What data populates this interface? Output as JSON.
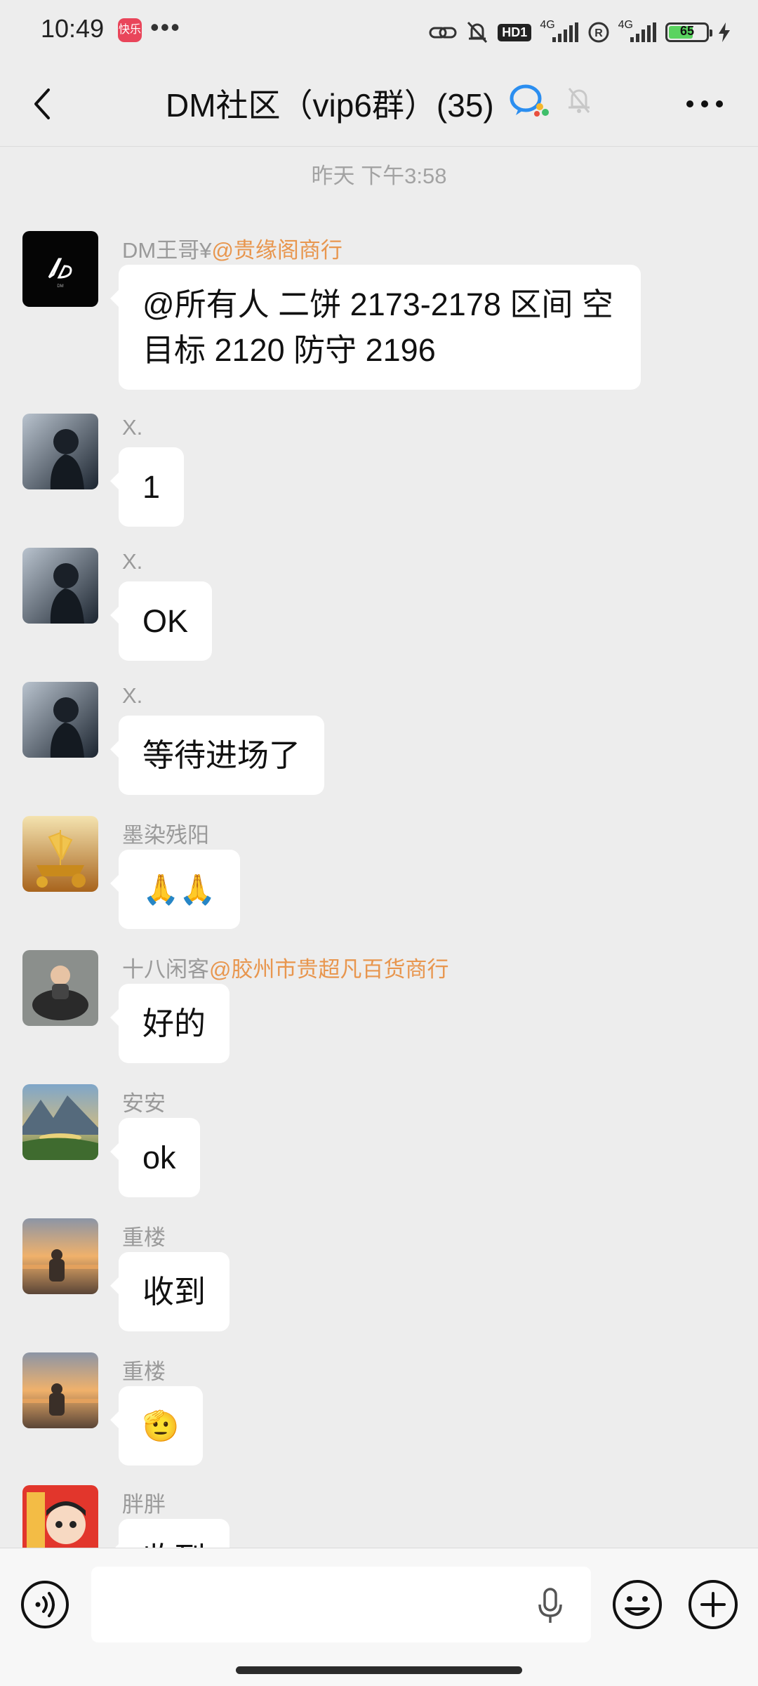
{
  "status_bar": {
    "time": "10:49",
    "app_icon_text": "快乐",
    "more_dots": "•••",
    "hd_badge": "HD1",
    "signal1_label": "4G",
    "signal2_label": "4G",
    "roaming_label": "R",
    "battery_percent": "65",
    "icons": [
      "link-icon",
      "mute-icon",
      "hd-icon",
      "signal-icon",
      "roaming-icon",
      "signal-icon",
      "battery-icon",
      "charging-icon"
    ]
  },
  "header": {
    "title": "DM社区（vip6群）(35)",
    "back_icon": "chevron-left-icon",
    "wecom_icon": "wecom-icon",
    "mute_icon": "bell-off-icon",
    "more_icon": "more-dots-icon"
  },
  "chat": {
    "timestamp": "昨天 下午3:58",
    "messages": [
      {
        "sender": "DM王哥¥",
        "mention": "@贵缘阁商行",
        "text": "@所有人 二饼 2173-2178 区间 空\n目标 2120 防守 2196",
        "avatar_label": "DM"
      },
      {
        "sender": "X.",
        "mention": "",
        "text": "1"
      },
      {
        "sender": "X.",
        "mention": "",
        "text": "OK"
      },
      {
        "sender": "X.",
        "mention": "",
        "text": "等待进场了"
      },
      {
        "sender": "墨染残阳",
        "mention": "",
        "text": "🙏🙏"
      },
      {
        "sender": "十八闲客",
        "mention": "@胶州市贵超凡百货商行",
        "text": "好的"
      },
      {
        "sender": "安安",
        "mention": "",
        "text": "ok"
      },
      {
        "sender": "重楼",
        "mention": "",
        "text": "收到"
      },
      {
        "sender": "重楼",
        "mention": "",
        "text": "🫡"
      },
      {
        "sender": "胖胖",
        "mention": "",
        "text": "收到"
      }
    ]
  },
  "input_bar": {
    "voice_icon": "voice-icon",
    "mic_icon": "mic-icon",
    "emoji_icon": "emoji-icon",
    "plus_icon": "plus-icon",
    "text_value": ""
  },
  "colors": {
    "background": "#ededed",
    "bubble": "#ffffff",
    "mention": "#e8964e",
    "meta_text": "#9a9a9a"
  }
}
